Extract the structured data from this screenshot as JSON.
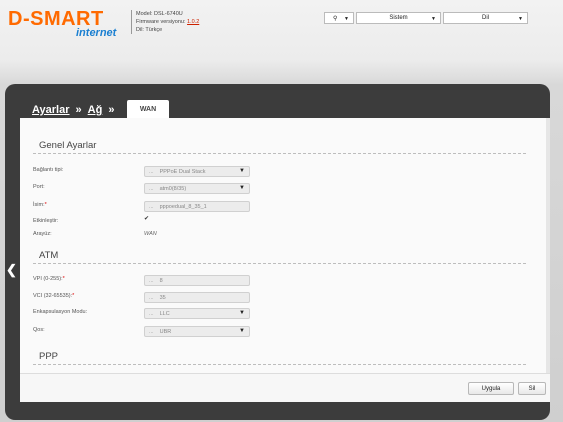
{
  "brand": {
    "logo_main": "D-SMART",
    "logo_sub": "internet",
    "logo_color": "#ff6a00",
    "sub_color": "#1a7fd1"
  },
  "device_info": {
    "model": "Model: DSL-6740U",
    "firmware_label": "Firmware versiyonu:",
    "firmware_version": "1.0.2",
    "language_line": "Dil: Türkçe"
  },
  "topbar": {
    "bulb_icon": "bulb-icon",
    "system_label": "Sistem",
    "language_label": "Dil"
  },
  "breadcrumb": {
    "settings": "Ayarlar",
    "separator1": "»",
    "network": "Ağ",
    "separator2": "»",
    "current_tab": "WAN"
  },
  "sections": {
    "general": {
      "title": "Genel Ayarlar",
      "connection_type_label": "Bağlantı tipi:",
      "connection_type_value": "PPPoE Dual Stack",
      "port_label": "Port:",
      "port_value": "atm0(8/35)",
      "name_label": "İsim:",
      "name_value": "pppoedual_8_35_1",
      "enable_label": "Etkinleştir:",
      "enable_checked": true,
      "enable_mark": "✔",
      "interface_label": "Arayüz:",
      "interface_value": "WAN"
    },
    "atm": {
      "title": "ATM",
      "vpi_label": "VPI (0-255):",
      "vpi_value": "8",
      "vci_label": "VCI (32-65535):",
      "vci_value": "35",
      "encap_label": "Enkapsulasyon Modu:",
      "encap_value": "LLC",
      "qos_label": "Qos:",
      "qos_value": "UBR"
    },
    "ppp": {
      "title": "PPP"
    }
  },
  "buttons": {
    "apply": "Uygula",
    "delete": "Sil"
  },
  "required_mark": "*",
  "field_prefix": "...",
  "dropdown_caret": "▼"
}
